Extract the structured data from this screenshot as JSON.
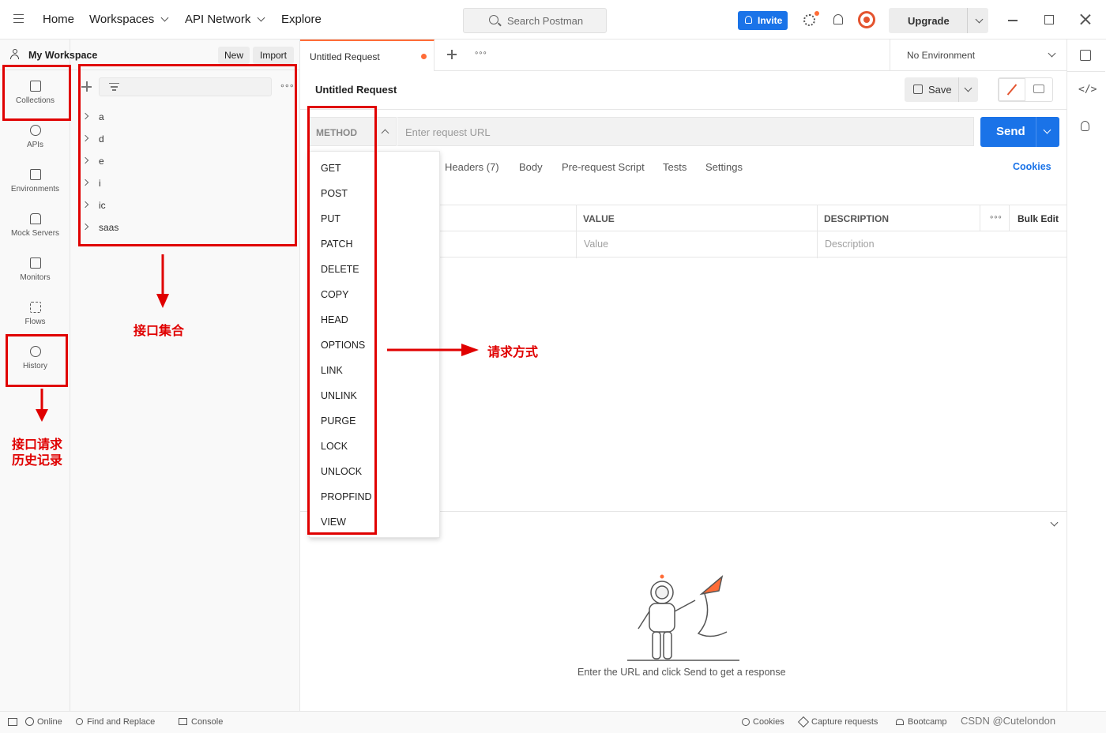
{
  "topbar": {
    "home": "Home",
    "workspaces": "Workspaces",
    "api_network": "API Network",
    "explore": "Explore",
    "search_placeholder": "Search Postman",
    "invite": "Invite",
    "upgrade": "Upgrade"
  },
  "sidebar": {
    "workspace": "My Workspace",
    "new": "New",
    "import": "Import",
    "rail": [
      {
        "label": "Collections",
        "icon": "collections-icon"
      },
      {
        "label": "APIs",
        "icon": "apis-icon"
      },
      {
        "label": "Environments",
        "icon": "environments-icon"
      },
      {
        "label": "Mock Servers",
        "icon": "mock-servers-icon"
      },
      {
        "label": "Monitors",
        "icon": "monitors-icon"
      },
      {
        "label": "Flows",
        "icon": "flows-icon"
      },
      {
        "label": "History",
        "icon": "history-icon"
      }
    ],
    "collections": [
      "a",
      "d",
      "e",
      "i",
      "ic",
      "saas"
    ]
  },
  "tabs": {
    "active": "Untitled Request",
    "environment": "No Environment"
  },
  "request": {
    "title": "Untitled Request",
    "save": "Save",
    "method": "METHOD",
    "url_placeholder": "Enter request URL",
    "send": "Send",
    "subtabs": [
      "Headers (7)",
      "Body",
      "Pre-request Script",
      "Tests",
      "Settings"
    ],
    "cookies": "Cookies",
    "columns": {
      "value": "VALUE",
      "description": "DESCRIPTION",
      "bulk_edit": "Bulk Edit"
    },
    "placeholders": {
      "value": "Value",
      "description": "Description"
    }
  },
  "methods": [
    "GET",
    "POST",
    "PUT",
    "PATCH",
    "DELETE",
    "COPY",
    "HEAD",
    "OPTIONS",
    "LINK",
    "UNLINK",
    "PURGE",
    "LOCK",
    "UNLOCK",
    "PROPFIND",
    "VIEW"
  ],
  "response": {
    "hint": "Enter the URL and click Send to get a response"
  },
  "statusbar": {
    "online": "Online",
    "find_replace": "Find and Replace",
    "console": "Console",
    "cookies": "Cookies",
    "capture": "Capture requests",
    "bootcamp": "Bootcamp",
    "watermark": "CSDN @Cutelondon"
  },
  "annotations": {
    "collections_label": "接口集合",
    "method_label": "请求方式",
    "history_label_line1": "接口请求",
    "history_label_line2": "历史记录"
  },
  "colors": {
    "accent": "#1a73e8",
    "annotation": "#e00000",
    "tab_indicator": "#ff6c37"
  }
}
